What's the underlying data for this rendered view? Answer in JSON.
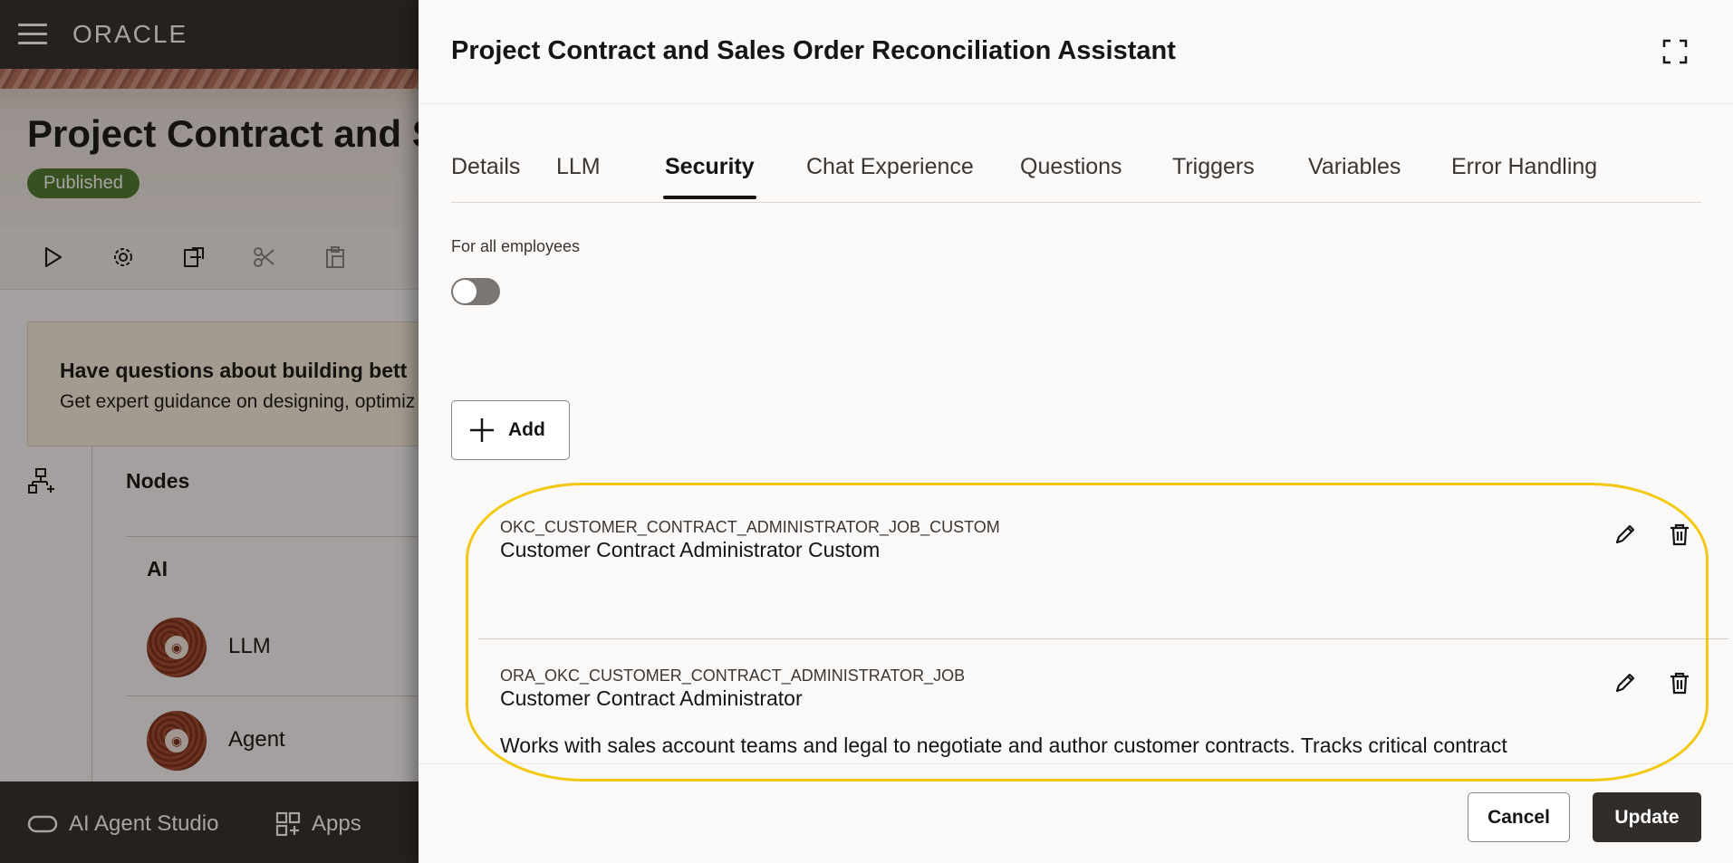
{
  "app": {
    "brand": "ORACLE"
  },
  "background": {
    "page_title": "Project Contract and S",
    "status_badge": "Published",
    "banner": {
      "title": "Have questions about building bett",
      "subtitle": "Get expert guidance on designing, optimiz"
    },
    "nodes": {
      "title": "Nodes",
      "group": "AI",
      "items": [
        {
          "label": "LLM"
        },
        {
          "label": "Agent"
        }
      ]
    },
    "bottom_nav": {
      "ai_agent_studio": "AI Agent Studio",
      "apps": "Apps"
    }
  },
  "drawer": {
    "title": "Project Contract and Sales Order Reconciliation Assistant",
    "tabs": [
      {
        "label": "Details"
      },
      {
        "label": "LLM"
      },
      {
        "label": "Security"
      },
      {
        "label": "Chat Experience"
      },
      {
        "label": "Questions"
      },
      {
        "label": "Triggers"
      },
      {
        "label": "Variables"
      },
      {
        "label": "Error Handling"
      }
    ],
    "active_tab": "Security",
    "for_all_employees_label": "For all employees",
    "for_all_employees_enabled": false,
    "add_label": "Add",
    "roles": [
      {
        "code": "OKC_CUSTOMER_CONTRACT_ADMINISTRATOR_JOB_CUSTOM",
        "name": "Customer Contract Administrator Custom",
        "description": ""
      },
      {
        "code": "ORA_OKC_CUSTOMER_CONTRACT_ADMINISTRATOR_JOB",
        "name": "Customer Contract Administrator",
        "description": "Works with sales account teams and legal to negotiate and author customer contracts. Tracks critical contract"
      }
    ],
    "cancel_label": "Cancel",
    "update_label": "Update"
  },
  "colors": {
    "header_bg": "#312d2a",
    "badge_green": "#4c7a2c",
    "highlight": "#f2c811",
    "primary_button": "#312d2a"
  }
}
